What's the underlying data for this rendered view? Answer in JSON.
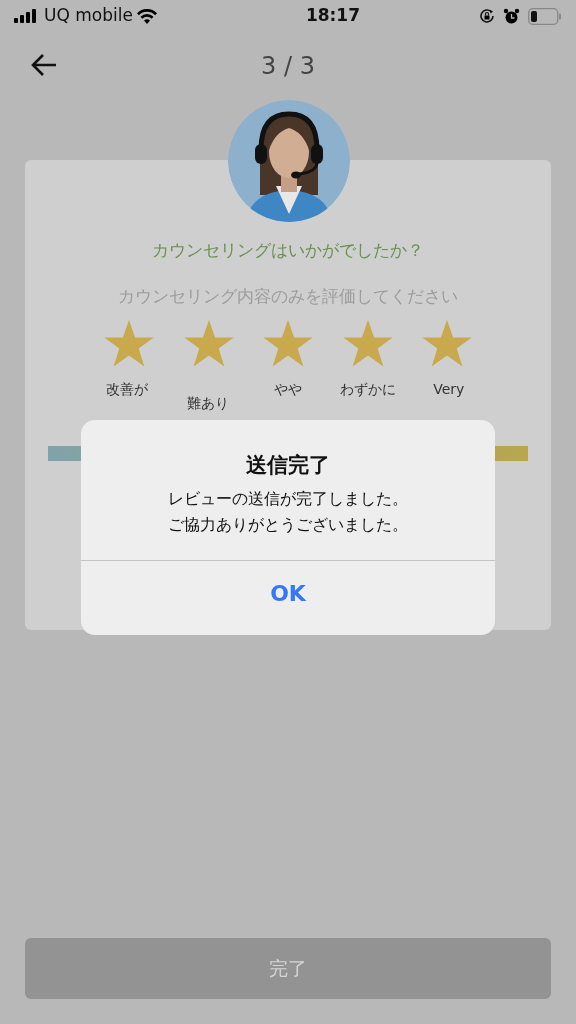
{
  "status_bar": {
    "carrier": "UQ mobile",
    "time": "18:17"
  },
  "header": {
    "progress": "3 / 3"
  },
  "card": {
    "question": "カウンセリングはいかがでしたか？",
    "instruction": "カウンセリング内容のみを評価してください",
    "rating": {
      "stars": 5
    },
    "labels": [
      {
        "text": "改善が",
        "offset": false
      },
      {
        "text": "難あり",
        "offset": true
      },
      {
        "text": "やや",
        "offset": false
      },
      {
        "text": "わずかに",
        "offset": false
      },
      {
        "text": "Very",
        "offset": false
      }
    ]
  },
  "alert": {
    "title": "送信完了",
    "message": [
      "レビューの送信が完了しました。",
      "ご協力ありがとうございました。"
    ],
    "button": "OK"
  },
  "footer": {
    "button": "完了",
    "disabled": true
  }
}
